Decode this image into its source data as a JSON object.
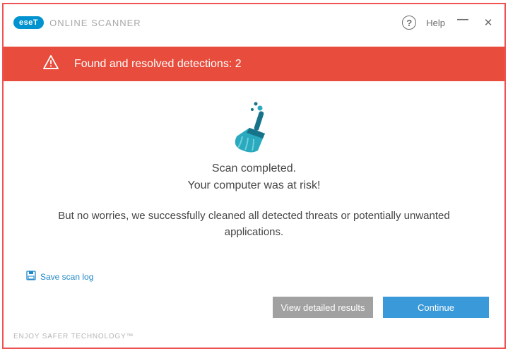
{
  "titlebar": {
    "brand_logo": "eseT",
    "brand_text": "ONLINE SCANNER",
    "help_label": "Help"
  },
  "alert": {
    "message": "Found and resolved detections: 2"
  },
  "content": {
    "title_line1": "Scan completed.",
    "title_line2": "Your computer was at risk!",
    "body": "But no worries, we successfully cleaned all detected threats or potentially unwanted applications."
  },
  "actions": {
    "save_log": "Save scan log",
    "view_details": "View detailed results",
    "continue": "Continue"
  },
  "footer": {
    "tagline": "ENJOY SAFER TECHNOLOGY™"
  },
  "colors": {
    "accent": "#3a99d8",
    "alert": "#e74c3c",
    "brand": "#0093d0"
  }
}
